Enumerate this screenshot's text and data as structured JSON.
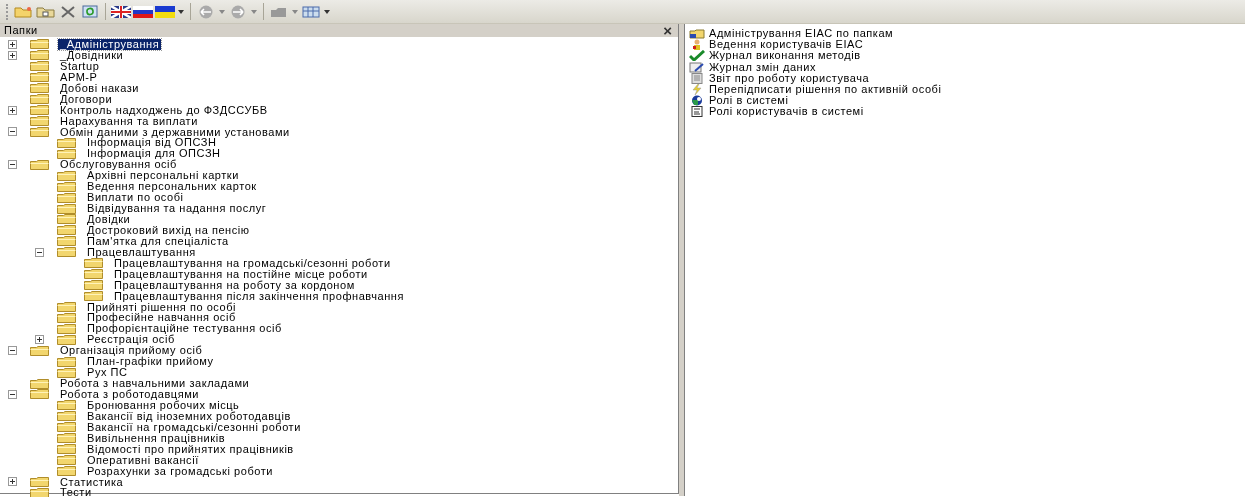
{
  "folders_panel": {
    "title": "Папки",
    "close_label": "×",
    "tree": [
      {
        "label": "_Адміністрування",
        "selected": true,
        "expanded": false
      },
      {
        "label": "_Довідники",
        "selected": false,
        "expanded": false
      },
      {
        "label": "Startup",
        "selected": false
      },
      {
        "label": "АРМ-Р",
        "selected": false
      },
      {
        "label": "Добові накази",
        "selected": false
      },
      {
        "label": "Договори",
        "selected": false
      },
      {
        "label": "Контроль надходжень до ФЗДССУБВ",
        "selected": false,
        "expanded": false
      },
      {
        "label": "Нарахування та виплати",
        "selected": false
      },
      {
        "label": "Обмін даними з державними установами",
        "selected": false,
        "expanded": true,
        "children": [
          {
            "label": "Інформація від ОПСЗН",
            "selected": false
          },
          {
            "label": "Інформація для ОПСЗН",
            "selected": false
          }
        ]
      },
      {
        "label": "Обслуговування осіб",
        "selected": false,
        "expanded": true,
        "children": [
          {
            "label": "Архівні персональні картки",
            "selected": false
          },
          {
            "label": "Ведення персональних карток",
            "selected": false
          },
          {
            "label": "Виплати по особі",
            "selected": false
          },
          {
            "label": "Відвідування та надання послуг",
            "selected": false
          },
          {
            "label": "Довідки",
            "selected": false
          },
          {
            "label": "Достроковий вихід на пенсію",
            "selected": false
          },
          {
            "label": "Пам'ятка для спеціаліста",
            "selected": false
          },
          {
            "label": "Працевлаштування",
            "selected": false,
            "expanded": true,
            "children": [
              {
                "label": "Працевлаштування на громадські/сезонні роботи",
                "selected": false
              },
              {
                "label": "Працевлаштування на постійне місце роботи",
                "selected": false
              },
              {
                "label": "Працевлаштування на роботу за кордоном",
                "selected": false
              },
              {
                "label": "Працевлаштування після закінчення профнавчання",
                "selected": false
              }
            ]
          },
          {
            "label": "Прийняті рішення по особі",
            "selected": false
          },
          {
            "label": "Професійне навчання осіб",
            "selected": false
          },
          {
            "label": "Профорієнтаційне тестування осіб",
            "selected": false
          },
          {
            "label": "Реєстрація осіб",
            "selected": false,
            "expanded": false
          }
        ]
      },
      {
        "label": "Організація прийому осіб",
        "selected": false,
        "expanded": true,
        "children": [
          {
            "label": "План-графіки прийому",
            "selected": false
          },
          {
            "label": "Рух ПС",
            "selected": false
          }
        ]
      },
      {
        "label": "Робота з навчальними закладами",
        "selected": false
      },
      {
        "label": "Робота з роботодавцями",
        "selected": false,
        "expanded": true,
        "children": [
          {
            "label": "Бронювання робочих місць",
            "selected": false
          },
          {
            "label": "Вакансії від іноземних роботодавців",
            "selected": false
          },
          {
            "label": "Вакансії на громадські/сезонні роботи",
            "selected": false
          },
          {
            "label": "Вивільнення працівників",
            "selected": false
          },
          {
            "label": "Відомості про прийнятих працівників",
            "selected": false
          },
          {
            "label": "Оперативні вакансії",
            "selected": false
          },
          {
            "label": "Розрахунки за громадські роботи",
            "selected": false
          }
        ]
      },
      {
        "label": "Статистика",
        "selected": false,
        "expanded": false
      },
      {
        "label": "Тести",
        "selected": false
      }
    ]
  },
  "contents": [
    {
      "label": "Адміністрування ЕІАС по папкам"
    },
    {
      "label": "Ведення користувачів ЕІАС"
    },
    {
      "label": "Журнал виконання методів"
    },
    {
      "label": "Журнал змін даних"
    },
    {
      "label": "Звіт про роботу користувача"
    },
    {
      "label": "Перепідписати рішення по активній особі"
    },
    {
      "label": "Ролі в системі"
    },
    {
      "label": "Ролі користувачів в системі"
    }
  ]
}
